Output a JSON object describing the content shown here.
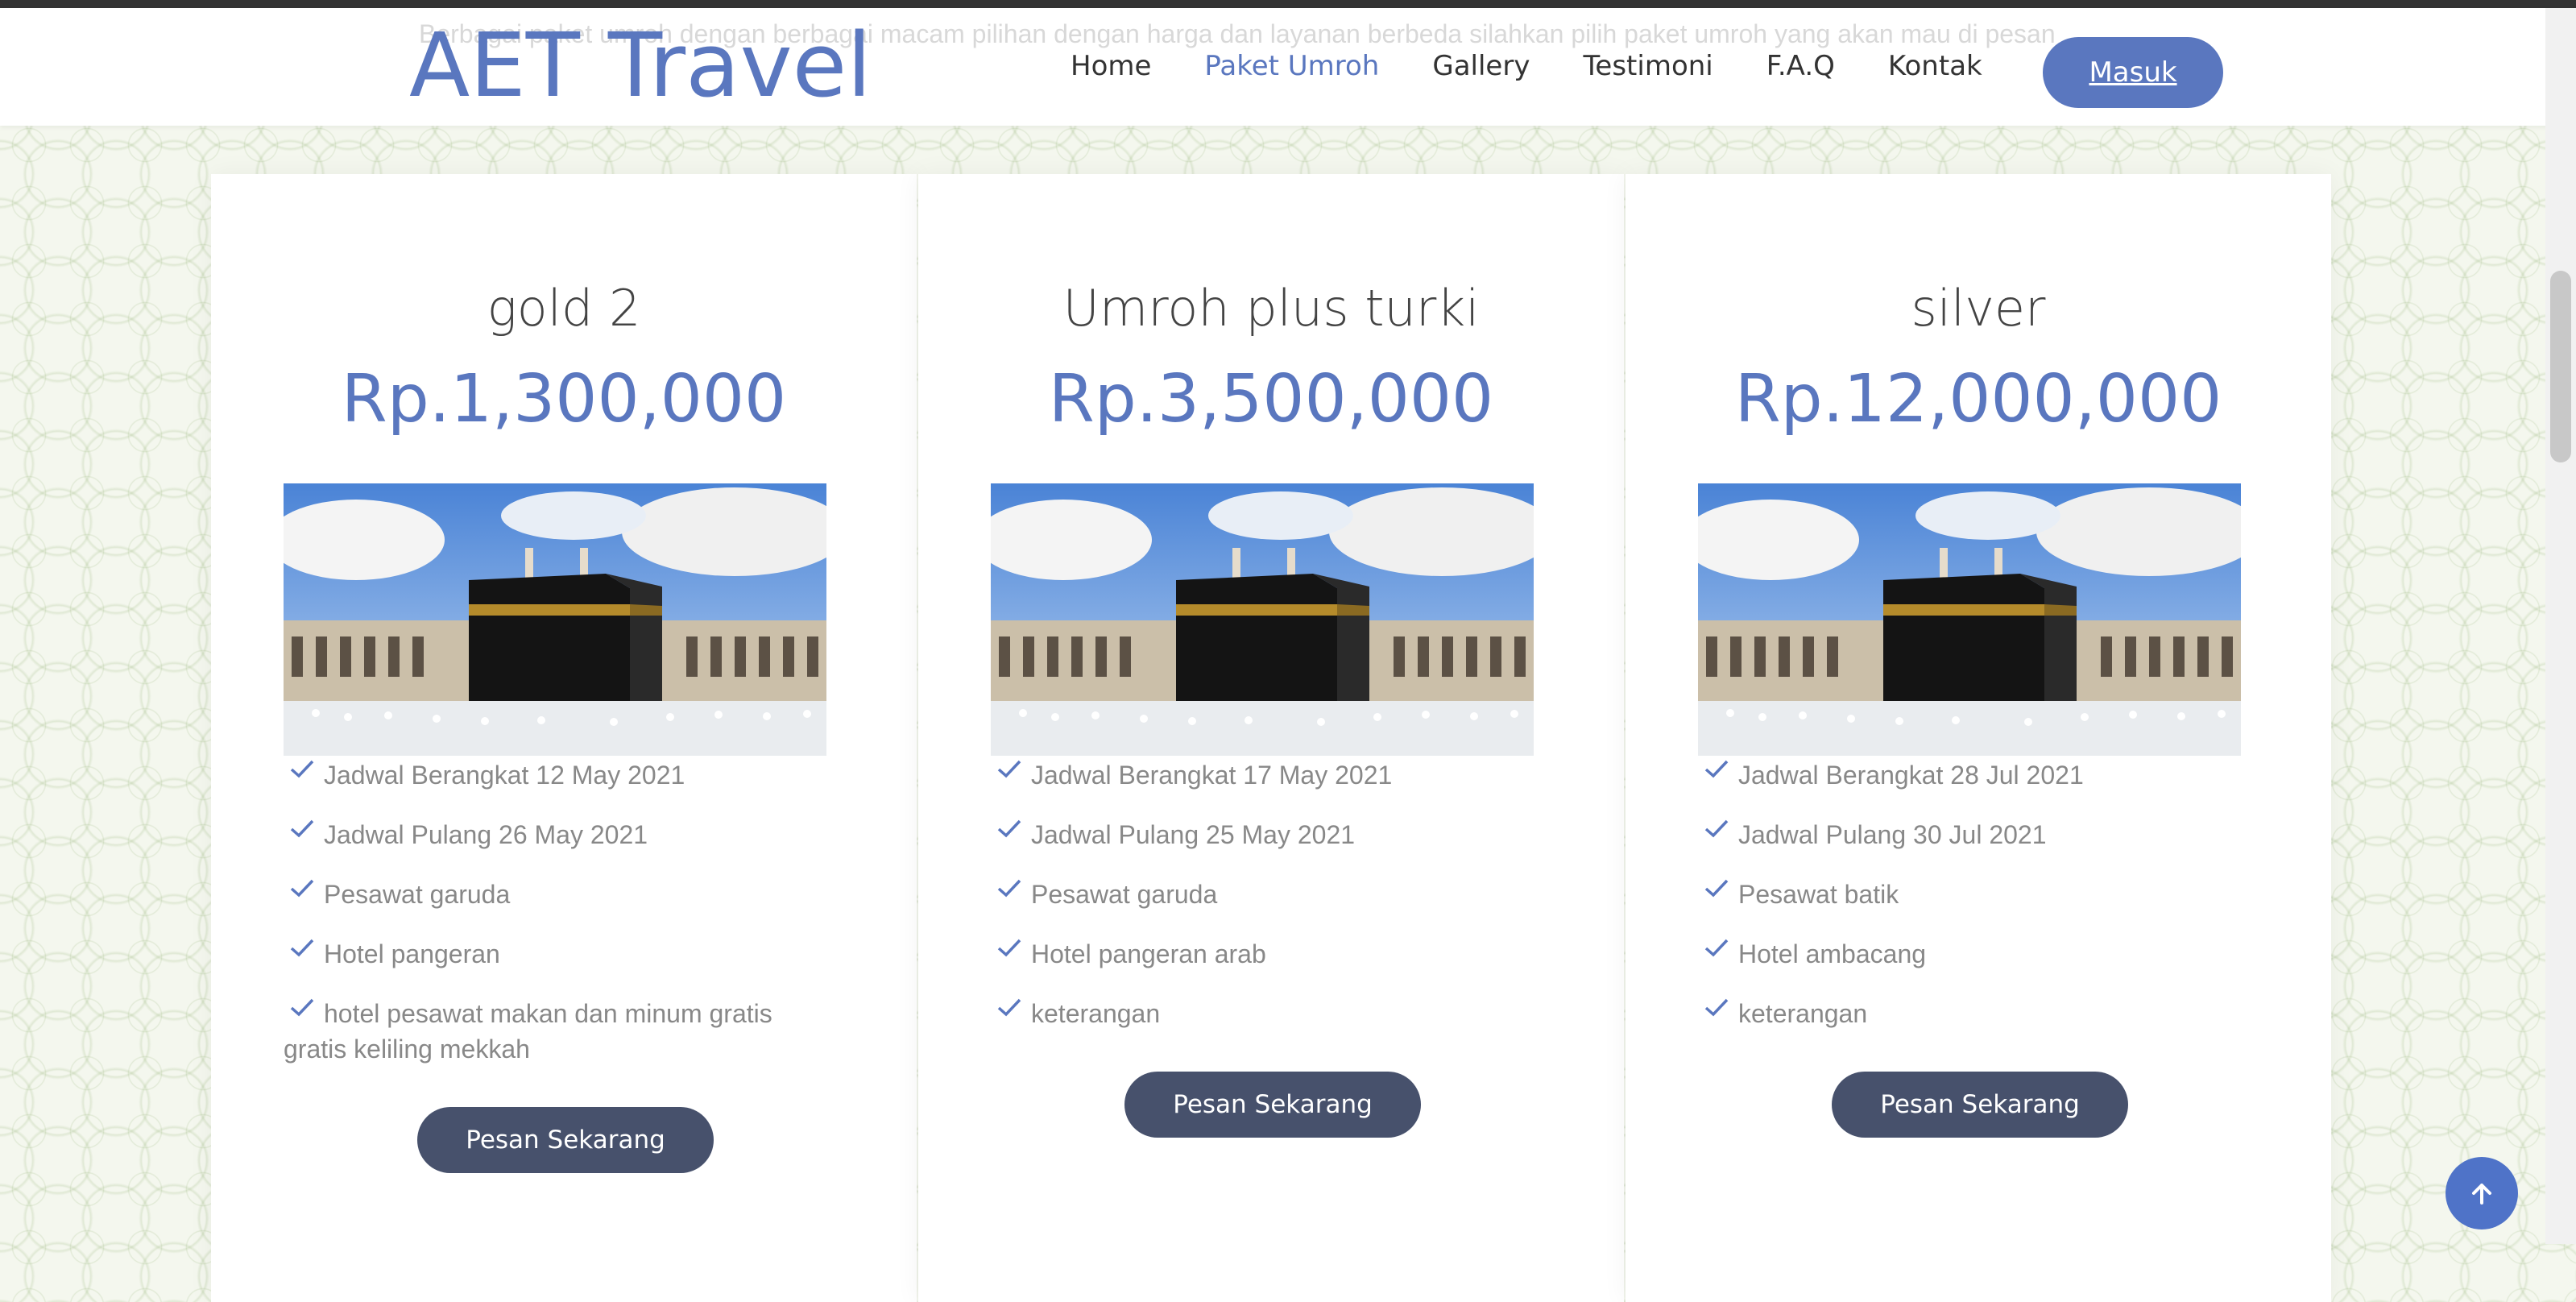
{
  "header": {
    "ghost_text": "Berbagai paket umroh dengan berbagai macam pilihan dengan harga dan layanan berbeda silahkan pilih paket umroh yang akan mau di pesan",
    "brand": "AET Travel",
    "nav": [
      "Home",
      "Paket Umroh",
      "Gallery",
      "Testimoni",
      "F.A.Q",
      "Kontak"
    ],
    "active_nav": "Paket Umroh",
    "login_label": "Masuk"
  },
  "packages": [
    {
      "title": "gold 2",
      "price": "Rp.1,300,000",
      "features": [
        "Jadwal Berangkat 12 May 2021",
        "Jadwal Pulang 26 May 2021",
        "Pesawat garuda",
        "Hotel pangeran",
        "hotel pesawat makan dan minum gratis gratis keliling mekkah"
      ],
      "button": "Pesan Sekarang"
    },
    {
      "title": "Umroh plus turki",
      "price": "Rp.3,500,000",
      "features": [
        "Jadwal Berangkat 17 May 2021",
        "Jadwal Pulang 25 May 2021",
        "Pesawat garuda",
        "Hotel pangeran arab",
        "keterangan"
      ],
      "button": "Pesan Sekarang"
    },
    {
      "title": "silver",
      "price": "Rp.12,000,000",
      "features": [
        "Jadwal Berangkat 28 Jul 2021",
        "Jadwal Pulang 30 Jul 2021",
        "Pesawat batik",
        "Hotel ambacang",
        "keterangan"
      ],
      "button": "Pesan Sekarang"
    }
  ],
  "colors": {
    "brand": "#5a77bf",
    "button": "#47516c",
    "text": "#888888"
  },
  "icons": {
    "feature": "check-icon",
    "scroll_top": "arrow-up-icon"
  }
}
